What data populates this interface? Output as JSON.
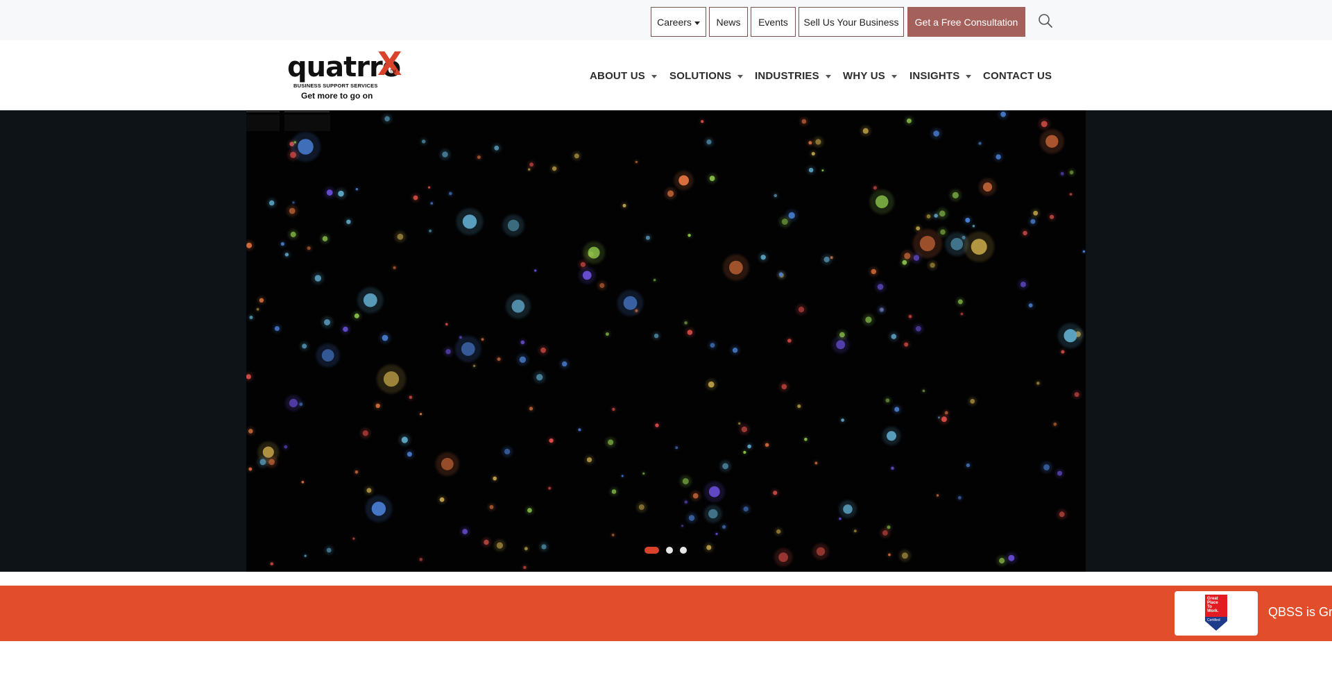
{
  "utility_bar": {
    "careers": "Careers",
    "news": "News",
    "events": "Events",
    "sell": "Sell Us Your Business",
    "consultation": "Get a Free Consultation"
  },
  "logo": {
    "wordmark": "quatrro",
    "sub": "BUSINESS SUPPORT SERVICES",
    "tagline": "Get more to go on"
  },
  "nav": {
    "about": "ABOUT US",
    "solutions": "SOLUTIONS",
    "industries": "INDUSTRIES",
    "why": "WHY US",
    "insights": "INSIGHTS",
    "contact": "CONTACT US"
  },
  "hero": {
    "slide_count": 3,
    "active_slide": 1
  },
  "award": {
    "badge_text": "Great Place To Work. Certified",
    "text": "QBSS is Gre"
  },
  "colors": {
    "accent": "#e24e2c",
    "button_primary": "#a4605b",
    "hero_bg": "#020203"
  }
}
